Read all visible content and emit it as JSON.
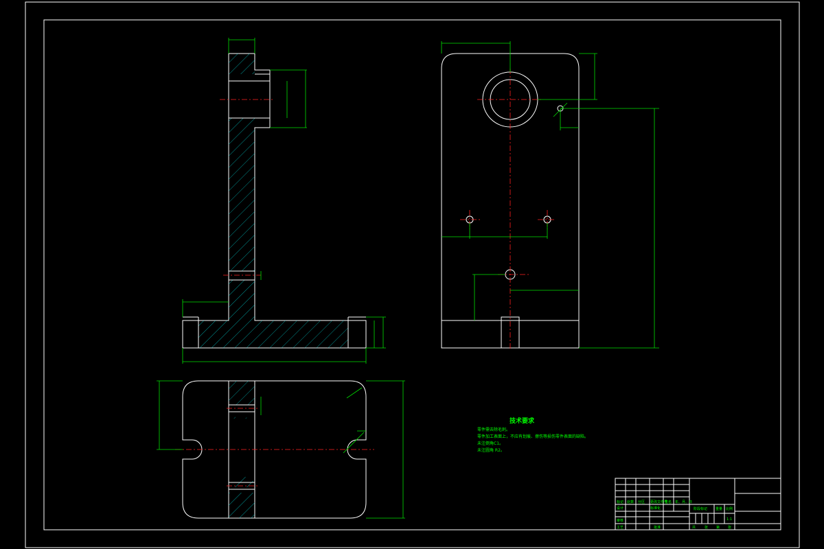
{
  "tech_requirements": {
    "title": "技术要求",
    "items": [
      "零件需去除毛刺。",
      "零件加工表面上，不应有划痕、擦伤等损伤零件表面的缺陷。",
      "未注倒角C1。",
      "未注圆角 R2。"
    ]
  },
  "title_block": {
    "row1": [
      "标记",
      "处数",
      "分区",
      "更改文件号",
      "签名",
      "年、月、日"
    ],
    "design_label": "设计",
    "standardize_label": "标准化",
    "review_label": "审核",
    "process_label": "工艺",
    "approve_label": "批准",
    "stage_label": "阶段标记",
    "weight_label": "重量",
    "scale_label": "比例",
    "scale_value": "1:1",
    "sheet_labels": [
      "共",
      "张",
      "第",
      "张"
    ]
  }
}
